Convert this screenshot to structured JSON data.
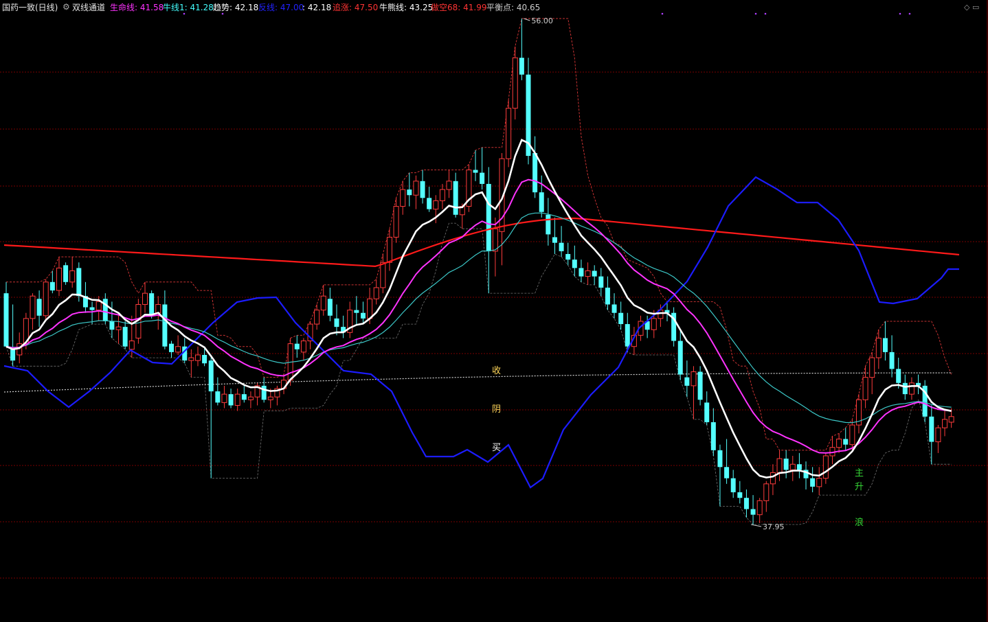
{
  "header": {
    "stock_name": "国药一致",
    "period": "(日线)",
    "indicator_name": "双线通道",
    "items": [
      {
        "label": "生命线",
        "value": "41.58",
        "color": "#ff33ff"
      },
      {
        "label": "牛线1",
        "value": "41.28",
        "color": "#44ffff"
      },
      {
        "label": "趋势",
        "value": "42.18",
        "color": "#ffffff"
      },
      {
        "label": "反线",
        "value": "47.00",
        "color": "#2222ff"
      },
      {
        "label": "",
        "value": "42.18",
        "color": "#ffffff"
      },
      {
        "label": "追涨",
        "value": "47.50",
        "color": "#ff3333"
      },
      {
        "label": "牛熊线",
        "value": "43.25",
        "color": "#ffffff"
      },
      {
        "label": "做空68",
        "value": "41.99",
        "color": "#ff3333"
      },
      {
        "label": "平衡点",
        "value": "40.65",
        "color": "#cccccc"
      }
    ]
  },
  "markers": {
    "price_high": "56.00",
    "price_low": "37.95",
    "signal_left": [
      "收",
      "阴",
      "买"
    ],
    "signal_right": [
      "主",
      "升",
      "浪"
    ]
  },
  "colors": {
    "background": "#000000",
    "grid": "#7a0000",
    "bull_candle": "#ff3c3c",
    "bear_candle": "#54ffff",
    "life_line": "#ff33ff",
    "trend_line": "#ffffff",
    "bull_bear_line": "#ff1a1a",
    "reverse_line": "#1c1cff",
    "cyan_line": "#3cc8c8",
    "channel": "#c83232",
    "balance": "#d0d0d0"
  },
  "chart_data": {
    "type": "candlestick",
    "ylim": [
      37.95,
      56.0
    ],
    "ohlc": [
      [
        46.2,
        46.6,
        44.3,
        44.3
      ],
      [
        44.2,
        45.8,
        43.6,
        43.8
      ],
      [
        44.0,
        44.8,
        43.7,
        44.4
      ],
      [
        44.4,
        45.5,
        44.2,
        45.3
      ],
      [
        45.3,
        46.2,
        44.9,
        46.1
      ],
      [
        46.0,
        46.3,
        45.0,
        45.4
      ],
      [
        45.4,
        46.7,
        45.2,
        46.6
      ],
      [
        46.6,
        47.0,
        46.2,
        46.3
      ],
      [
        46.3,
        47.5,
        46.1,
        47.1
      ],
      [
        47.2,
        47.3,
        46.5,
        46.6
      ],
      [
        46.6,
        47.5,
        46.4,
        47.0
      ],
      [
        47.1,
        47.3,
        45.9,
        46.1
      ],
      [
        46.1,
        46.6,
        45.5,
        45.7
      ],
      [
        45.7,
        45.9,
        45.1,
        45.6
      ],
      [
        45.6,
        46.1,
        45.2,
        45.9
      ],
      [
        46.0,
        46.2,
        45.1,
        45.2
      ],
      [
        45.2,
        45.9,
        44.6,
        44.9
      ],
      [
        44.9,
        45.4,
        44.4,
        45.0
      ],
      [
        45.0,
        45.2,
        44.2,
        44.3
      ],
      [
        44.2,
        45.4,
        43.9,
        44.5
      ],
      [
        44.6,
        46.0,
        44.4,
        45.8
      ],
      [
        45.8,
        46.6,
        45.5,
        46.2
      ],
      [
        46.2,
        46.3,
        45.3,
        45.4
      ],
      [
        45.5,
        46.1,
        44.9,
        45.8
      ],
      [
        45.8,
        46.3,
        44.2,
        44.3
      ],
      [
        44.4,
        44.5,
        43.9,
        44.1
      ],
      [
        44.1,
        44.7,
        44.0,
        44.3
      ],
      [
        44.3,
        44.6,
        43.7,
        43.8
      ],
      [
        43.8,
        44.2,
        43.2,
        43.9
      ],
      [
        43.8,
        44.3,
        43.6,
        44.0
      ],
      [
        44.0,
        44.3,
        43.6,
        43.7
      ],
      [
        43.8,
        44.0,
        39.6,
        42.7
      ],
      [
        42.7,
        43.2,
        42.2,
        42.3
      ],
      [
        42.3,
        42.9,
        42.1,
        42.6
      ],
      [
        42.6,
        42.8,
        42.1,
        42.2
      ],
      [
        42.2,
        42.8,
        42.0,
        42.6
      ],
      [
        42.6,
        42.9,
        42.3,
        42.4
      ],
      [
        42.4,
        42.7,
        42.1,
        42.5
      ],
      [
        42.5,
        43.0,
        42.2,
        42.9
      ],
      [
        42.9,
        43.2,
        42.3,
        42.4
      ],
      [
        42.4,
        42.8,
        42.1,
        42.5
      ],
      [
        42.5,
        42.9,
        42.2,
        42.8
      ],
      [
        42.8,
        43.3,
        42.6,
        43.1
      ],
      [
        43.1,
        44.6,
        42.9,
        44.4
      ],
      [
        44.4,
        44.7,
        43.9,
        44.2
      ],
      [
        44.1,
        44.6,
        43.8,
        44.5
      ],
      [
        44.5,
        45.2,
        44.2,
        45.1
      ],
      [
        45.1,
        45.8,
        44.9,
        45.6
      ],
      [
        45.6,
        46.5,
        45.4,
        46.1
      ],
      [
        46.0,
        46.4,
        45.2,
        45.4
      ],
      [
        45.3,
        45.8,
        44.7,
        45.0
      ],
      [
        45.0,
        45.4,
        44.6,
        44.8
      ],
      [
        44.8,
        45.9,
        44.6,
        45.6
      ],
      [
        45.6,
        46.1,
        45.1,
        45.5
      ],
      [
        45.5,
        45.9,
        45.1,
        45.3
      ],
      [
        45.3,
        46.4,
        45.1,
        46.0
      ],
      [
        46.0,
        46.7,
        45.8,
        46.4
      ],
      [
        46.4,
        47.6,
        46.2,
        47.3
      ],
      [
        47.3,
        48.5,
        47.0,
        48.2
      ],
      [
        48.2,
        49.6,
        48.0,
        49.3
      ],
      [
        49.3,
        50.2,
        49.0,
        49.9
      ],
      [
        49.9,
        50.5,
        49.3,
        49.7
      ],
      [
        49.7,
        50.4,
        49.2,
        50.2
      ],
      [
        50.2,
        50.6,
        49.4,
        49.6
      ],
      [
        49.6,
        50.0,
        49.1,
        49.2
      ],
      [
        49.2,
        49.7,
        48.7,
        49.5
      ],
      [
        49.5,
        50.1,
        49.2,
        49.9
      ],
      [
        49.9,
        50.6,
        49.6,
        50.2
      ],
      [
        50.2,
        50.5,
        48.9,
        49.0
      ],
      [
        49.0,
        49.4,
        48.5,
        49.3
      ],
      [
        49.3,
        50.8,
        49.1,
        50.6
      ],
      [
        50.6,
        51.3,
        50.2,
        50.5
      ],
      [
        50.5,
        51.4,
        49.9,
        50.1
      ],
      [
        50.1,
        50.7,
        46.2,
        47.7
      ],
      [
        47.7,
        48.9,
        46.8,
        48.5
      ],
      [
        48.4,
        51.2,
        47.2,
        51.0
      ],
      [
        51.0,
        53.1,
        50.7,
        52.8
      ],
      [
        52.8,
        55.0,
        52.4,
        54.6
      ],
      [
        54.6,
        56.0,
        53.8,
        54.0
      ],
      [
        54.0,
        54.6,
        50.8,
        51.1
      ],
      [
        51.2,
        51.8,
        49.6,
        49.8
      ],
      [
        49.8,
        50.4,
        48.9,
        49.1
      ],
      [
        49.0,
        49.6,
        47.9,
        48.3
      ],
      [
        48.2,
        48.9,
        47.6,
        48.0
      ],
      [
        48.0,
        48.6,
        47.5,
        47.7
      ],
      [
        47.6,
        48.0,
        47.2,
        47.4
      ],
      [
        47.4,
        47.9,
        46.8,
        47.1
      ],
      [
        47.1,
        47.4,
        46.6,
        46.8
      ],
      [
        46.8,
        47.3,
        46.5,
        47.0
      ],
      [
        47.0,
        47.2,
        46.5,
        46.8
      ],
      [
        46.8,
        47.1,
        46.1,
        46.4
      ],
      [
        46.4,
        46.8,
        45.6,
        45.8
      ],
      [
        45.8,
        46.2,
        45.3,
        45.5
      ],
      [
        45.5,
        45.9,
        44.9,
        45.1
      ],
      [
        45.1,
        45.5,
        44.1,
        44.3
      ],
      [
        44.3,
        45.0,
        44.0,
        44.7
      ],
      [
        44.7,
        45.4,
        44.5,
        45.2
      ],
      [
        45.2,
        45.4,
        44.6,
        44.9
      ],
      [
        44.9,
        45.6,
        44.6,
        45.3
      ],
      [
        45.3,
        45.8,
        45.0,
        45.6
      ],
      [
        45.6,
        45.9,
        45.2,
        45.5
      ],
      [
        45.5,
        45.7,
        44.3,
        44.5
      ],
      [
        44.5,
        44.9,
        43.1,
        43.3
      ],
      [
        43.2,
        43.8,
        42.5,
        42.9
      ],
      [
        42.9,
        43.6,
        41.7,
        43.4
      ],
      [
        43.4,
        43.6,
        42.2,
        42.4
      ],
      [
        42.3,
        42.7,
        41.5,
        41.6
      ],
      [
        41.6,
        42.1,
        40.4,
        40.6
      ],
      [
        40.6,
        40.8,
        38.6,
        40.0
      ],
      [
        40.0,
        41.0,
        39.4,
        39.6
      ],
      [
        39.6,
        39.9,
        38.9,
        39.1
      ],
      [
        39.1,
        39.5,
        38.7,
        38.9
      ],
      [
        38.9,
        39.2,
        38.2,
        38.5
      ],
      [
        38.5,
        39.0,
        37.95,
        38.3
      ],
      [
        38.3,
        38.9,
        38.0,
        38.8
      ],
      [
        38.8,
        39.5,
        38.4,
        39.4
      ],
      [
        39.4,
        40.1,
        39.0,
        39.8
      ],
      [
        39.8,
        40.6,
        39.5,
        40.3
      ],
      [
        40.3,
        40.6,
        39.6,
        39.9
      ],
      [
        39.9,
        40.4,
        39.5,
        40.1
      ],
      [
        40.1,
        40.5,
        39.6,
        39.9
      ],
      [
        39.9,
        40.2,
        39.2,
        39.6
      ],
      [
        39.6,
        40.0,
        39.1,
        39.3
      ],
      [
        39.3,
        40.0,
        39.0,
        39.6
      ],
      [
        39.6,
        40.5,
        39.4,
        40.4
      ],
      [
        40.4,
        41.1,
        40.1,
        40.7
      ],
      [
        40.7,
        41.2,
        40.5,
        41.0
      ],
      [
        41.0,
        41.4,
        40.6,
        40.8
      ],
      [
        40.8,
        41.7,
        40.6,
        41.5
      ],
      [
        41.5,
        42.6,
        41.2,
        42.4
      ],
      [
        42.4,
        43.6,
        42.1,
        43.2
      ],
      [
        43.2,
        44.1,
        42.6,
        43.9
      ],
      [
        43.9,
        44.9,
        43.5,
        44.6
      ],
      [
        44.6,
        45.2,
        43.8,
        44.1
      ],
      [
        44.1,
        44.7,
        43.2,
        43.5
      ],
      [
        43.5,
        43.9,
        42.8,
        43.0
      ],
      [
        43.0,
        43.3,
        42.4,
        42.6
      ],
      [
        42.6,
        43.2,
        42.4,
        43.0
      ],
      [
        43.0,
        43.3,
        42.6,
        42.9
      ],
      [
        42.9,
        43.1,
        41.6,
        41.8
      ],
      [
        41.8,
        42.2,
        40.1,
        40.9
      ],
      [
        40.9,
        41.5,
        40.5,
        41.4
      ],
      [
        41.4,
        42.0,
        41.1,
        41.7
      ],
      [
        41.6,
        42.1,
        41.4,
        41.8
      ]
    ]
  }
}
